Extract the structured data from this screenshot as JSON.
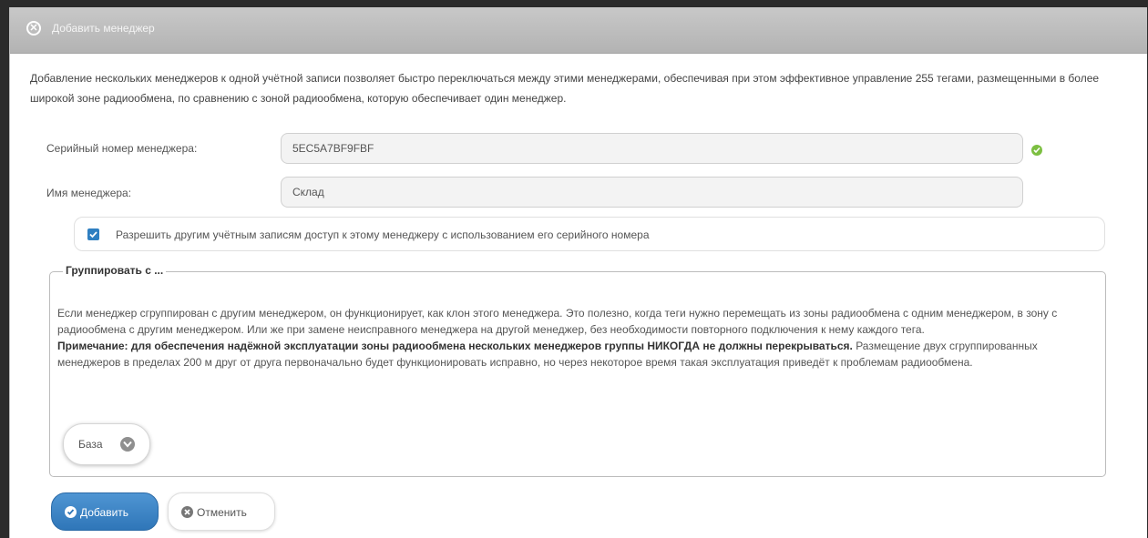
{
  "dialog": {
    "title": "Добавить менеджер",
    "intro": "Добавление нескольких менеджеров к одной учётной записи позволяет быстро переключаться между этими менеджерами, обеспечивая при этом эффективное управление 255 тегами, размещенными в более широкой зоне радиообмена, по сравнению с зоной радиообмена, которую обеспечивает один менеджер."
  },
  "form": {
    "serial_label": "Серийный номер менеджера:",
    "serial_value": "5EC5A7BF9FBF",
    "name_label": "Имя менеджера:",
    "name_value": "Склад",
    "allow_access_label": "Разрешить другим учётным записям доступ к этому менеджеру с использованием его серийного номера",
    "allow_access_checked": true
  },
  "group": {
    "legend": "Группировать с ...",
    "text1": "Если менеджер сгруппирован с другим менеджером, он функционирует, как клон этого менеджера. Это полезно, когда теги нужно перемещать из зоны радиообмена с одним менеджером, в зону с радиообмена с другим менеджером. Или же при замене неисправного менеджера на другой менеджер, без необходимости повторного подключения к нему каждого тега.",
    "note_bold": "Примечание: для обеспечения надёжной эксплуатации зоны радиообмена нескольких менеджеров группы НИКОГДА не должны перекрываться.",
    "note_rest": " Размещение двух сгруппированных менеджеров в пределах 200 м друг от друга первоначально будет функционировать исправно, но через некоторое время такая эксплуатация приведёт к проблемам радиообмена.",
    "select_value": "База"
  },
  "buttons": {
    "add": "Добавить",
    "cancel": "Отменить"
  },
  "colors": {
    "titlebar": "#b9b9b9",
    "primary": "#2f76b8",
    "ok": "#7cbf41"
  }
}
